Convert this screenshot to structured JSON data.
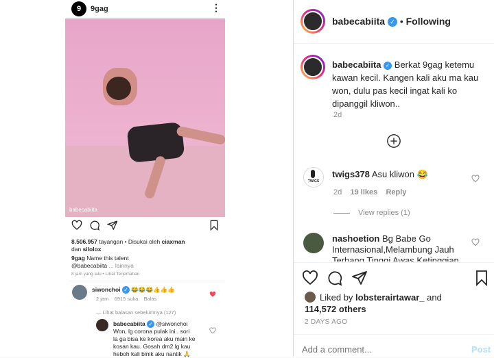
{
  "left_post": {
    "account": "9gag",
    "watermark": "babecabiita",
    "views": "8.506.957",
    "views_label": "tayangan",
    "liked_prefix": "Disukai oleh",
    "liked_user": "ciaxman",
    "and_word": "dan",
    "liked_user2": "silolox",
    "caption_user": "9gag",
    "caption_text": "Name this talent",
    "mention": "@babecabiita",
    "more": "... lainnya",
    "time": "8 jam yang lalu",
    "translate": "Lihat Terjemahan",
    "comment1": {
      "user": "siwonchoi",
      "emojis": "😂😂😂👍👍👍",
      "time": "2 jam",
      "likes": "6915 suka",
      "reply": "Balas"
    },
    "view_prev": "Lihat balasan sebelumnya (127)",
    "reply1": {
      "user": "babecabiita",
      "text1": "@siwonchoi",
      "text2": "Won, lg corona pulak ini.. sori",
      "text3": "la ga bisa ke korea aku main ke",
      "text4": "kosan kau. Gosah dm2 lg kau",
      "text5": "heboh kali binik aku nantik 🙏"
    }
  },
  "header": {
    "username": "babecabiita",
    "separator": "•",
    "follow_state": "Following"
  },
  "caption": {
    "username": "babecabiita",
    "text": "Berkat 9gag ketemu kawan kecil. Kangen kali aku ma kau won, dulu pas kecil ingat kali ko dipanggil kliwon..",
    "age": "2d"
  },
  "comments": [
    {
      "username": "twigs378",
      "text": "Asu kliwon 😂",
      "age": "2d",
      "likes": "19 likes",
      "reply": "Reply",
      "view_replies": "View replies (1)",
      "avatar_text": "TWIGS"
    },
    {
      "username": "nashoetion",
      "text": "Bg Babe Go Internasional,Melambung Jauh Terbang Tinggi Awas Ketinggian"
    }
  ],
  "liked": {
    "prefix": "Liked by",
    "user": "lobsterairtawar_",
    "and_word": "and",
    "count": "114,572 others"
  },
  "age_label": "2 DAYS AGO",
  "add_comment": {
    "placeholder": "Add a comment...",
    "post_label": "Post"
  },
  "colors": {
    "accent": "#0095f6",
    "verified": "#3897f0",
    "like_red": "#ed4956"
  },
  "icons": [
    "heart-icon",
    "comment-icon",
    "share-icon",
    "bookmark-icon",
    "more-icon",
    "add-circle-icon",
    "verified-icon"
  ]
}
